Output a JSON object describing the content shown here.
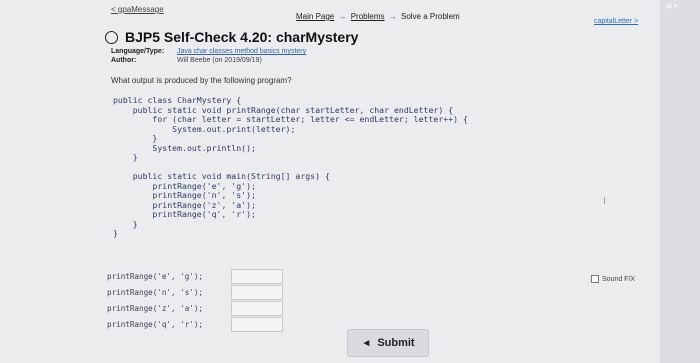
{
  "nav": {
    "prev_link": "< gpaMessage",
    "crumbs": [
      "Main Page",
      "Problems",
      "Solve a Problem"
    ],
    "crumb_sep": "→",
    "next_link": "capitalLetter >"
  },
  "problem": {
    "title": "BJP5 Self-Check 4.20: charMystery",
    "language_label": "Language/Type:",
    "language_value": "Java char classes method basics mystery",
    "author_label": "Author:",
    "author_value": "Will Beebe (on 2019/09/19)",
    "question": "What output is produced by the following program?"
  },
  "code": "public class CharMystery {\n    public static void printRange(char startLetter, char endLetter) {\n        for (char letter = startLetter; letter <= endLetter; letter++) {\n            System.out.print(letter);\n        }\n        System.out.println();\n    }\n\n    public static void main(String[] args) {\n        printRange('e', 'g');\n        printRange('n', 's');\n        printRange('z', 'a');\n        printRange('q', 'r');\n    }\n}",
  "answers": [
    {
      "label": "printRange('e', 'g');",
      "value": ""
    },
    {
      "label": "printRange('n', 's');",
      "value": ""
    },
    {
      "label": "printRange('z', 'a');",
      "value": ""
    },
    {
      "label": "printRange('q', 'r');",
      "value": ""
    }
  ],
  "sound_fx_label": "Sound F/X",
  "cursor_glyph": "I",
  "submit_label": "Submit",
  "colors": {
    "link": "#1a73c9",
    "code": "#2a3d6b",
    "background": "#ececee"
  }
}
